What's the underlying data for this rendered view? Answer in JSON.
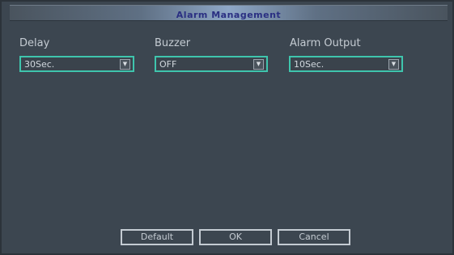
{
  "window": {
    "title": "Alarm Management"
  },
  "fields": {
    "delay": {
      "label": "Delay",
      "value": "30Sec."
    },
    "buzzer": {
      "label": "Buzzer",
      "value": "OFF"
    },
    "output": {
      "label": "Alarm Output",
      "value": "10Sec."
    }
  },
  "buttons": {
    "default": "Default",
    "ok": "OK",
    "cancel": "Cancel"
  },
  "colors": {
    "accent": "#3fc5ad",
    "background": "#3c4650",
    "title_text": "#2a2f82"
  },
  "icons": {
    "dropdown": "chevron-down-icon"
  }
}
